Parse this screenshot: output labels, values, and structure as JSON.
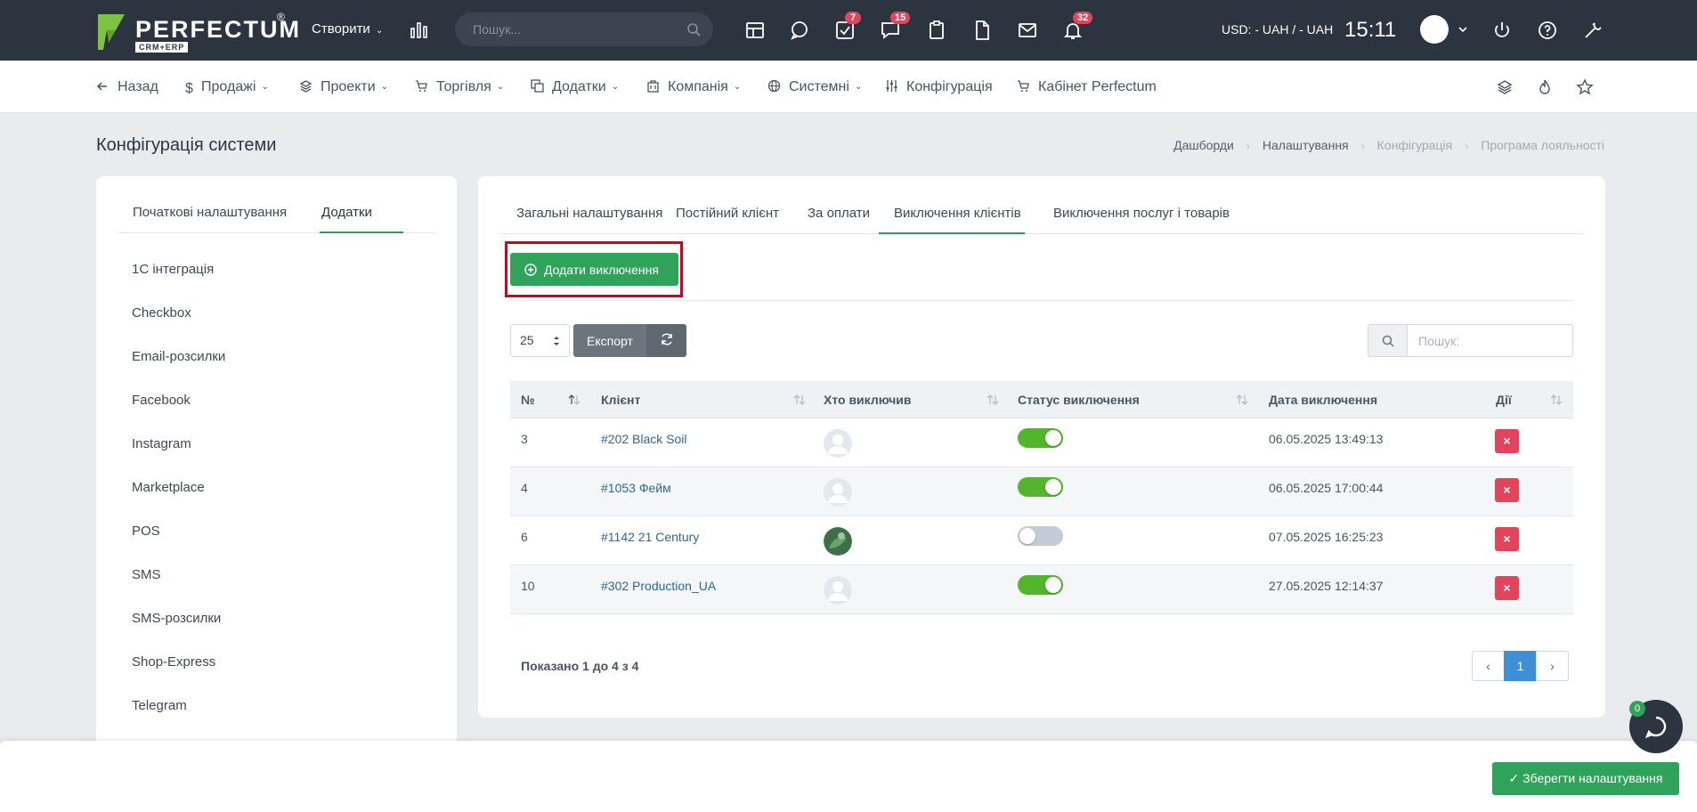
{
  "topbar": {
    "logo_text": "PERFECTUM",
    "logo_reg": "®",
    "logo_sub": "CRM+ERP",
    "create_label": "Створити",
    "search_placeholder": "Пошук...",
    "badges": {
      "tasks": "7",
      "chat": "15",
      "notifications": "32"
    },
    "currency": "USD: - UAH / - UAH",
    "time": "15:11"
  },
  "nav": {
    "back": "Назад",
    "sales": "Продажі",
    "projects": "Проекти",
    "trade": "Торгівля",
    "addons": "Додатки",
    "company": "Компанія",
    "system": "Системні",
    "config": "Конфігурація",
    "cabinet": "Кабінет Perfectum"
  },
  "page": {
    "title": "Конфігурація системи",
    "breadcrumb": [
      "Дашборди",
      "Налаштування",
      "Конфігурація",
      "Програма лояльності"
    ]
  },
  "left": {
    "tabs": [
      "Початкові налаштування",
      "Додатки"
    ],
    "items": [
      "1С інтеграція",
      "Checkbox",
      "Email-розсилки",
      "Facebook",
      "Instagram",
      "Marketplace",
      "POS",
      "SMS",
      "SMS-розсилки",
      "Shop-Express",
      "Telegram"
    ]
  },
  "main": {
    "tabs": [
      "Загальні налаштування",
      "Постійний клієнт",
      "За оплати",
      "Виключення клієнтів",
      "Виключення послуг і товарів"
    ],
    "add_button": "Додати виключення",
    "page_length": "25",
    "export_label": "Експорт",
    "search_placeholder": "Пошук:",
    "columns": [
      "№",
      "Клієнт",
      "Хто виключив",
      "Статус виключення",
      "Дата виключення",
      "Дії"
    ],
    "rows": [
      {
        "no": "3",
        "client": "#202 Black Soil",
        "status_on": true,
        "date": "06.05.2025 13:49:13"
      },
      {
        "no": "4",
        "client": "#1053 Фейм",
        "status_on": true,
        "date": "06.05.2025 17:00:44"
      },
      {
        "no": "6",
        "client": "#1142 21 Century",
        "status_on": false,
        "date": "07.05.2025 16:25:23"
      },
      {
        "no": "10",
        "client": "#302 Production_UA",
        "status_on": true,
        "date": "27.05.2025 12:14:37"
      }
    ],
    "delete_glyph": "×",
    "info": "Показано 1 до 4 з 4",
    "pager": {
      "prev": "‹",
      "current": "1",
      "next": "›"
    }
  },
  "footer": {
    "save_label": "Зберегти налаштування",
    "chat_badge": "0"
  },
  "colors": {
    "topbar": "#2c343f",
    "accent_green": "#2fa35a",
    "danger": "#e2445c",
    "toggle_on": "#52b52c",
    "toggle_off": "#c3cbd6",
    "highlight_frame": "#d0021b",
    "link": "#2e6794"
  }
}
